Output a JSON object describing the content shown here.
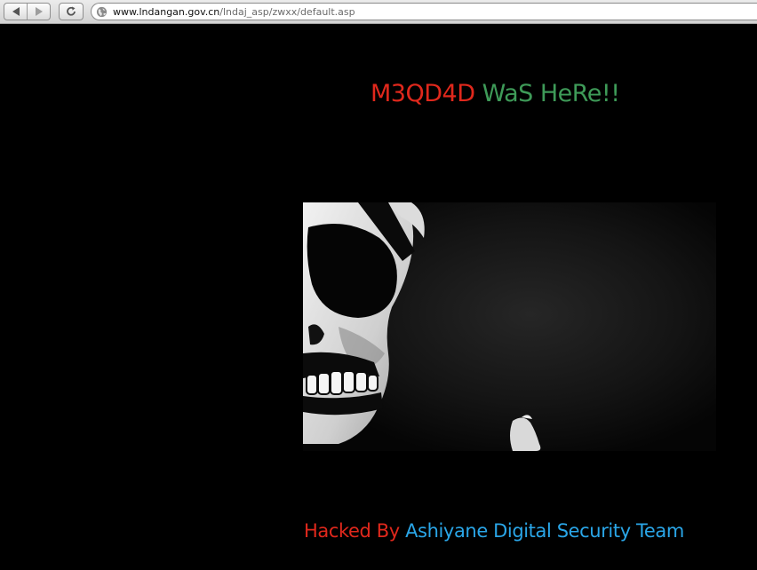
{
  "browser": {
    "url_host": "www.lndangan.gov.cn",
    "url_path": "/lndaj_asp/zwxx/default.asp"
  },
  "page": {
    "headline_handle": "M3QD4D",
    "headline_rest": "WaS HeRe!!",
    "footer_prefix": "Hacked By",
    "footer_team": "Ashiyane Digital Security Team"
  },
  "icons": {
    "back": "back-arrow-icon",
    "forward": "forward-arrow-icon",
    "reload": "reload-icon",
    "site": "globe-icon"
  },
  "colors": {
    "background": "#000000",
    "red_text": "#e0281c",
    "green_text": "#3e9a58",
    "blue_text": "#2aa6e8"
  }
}
